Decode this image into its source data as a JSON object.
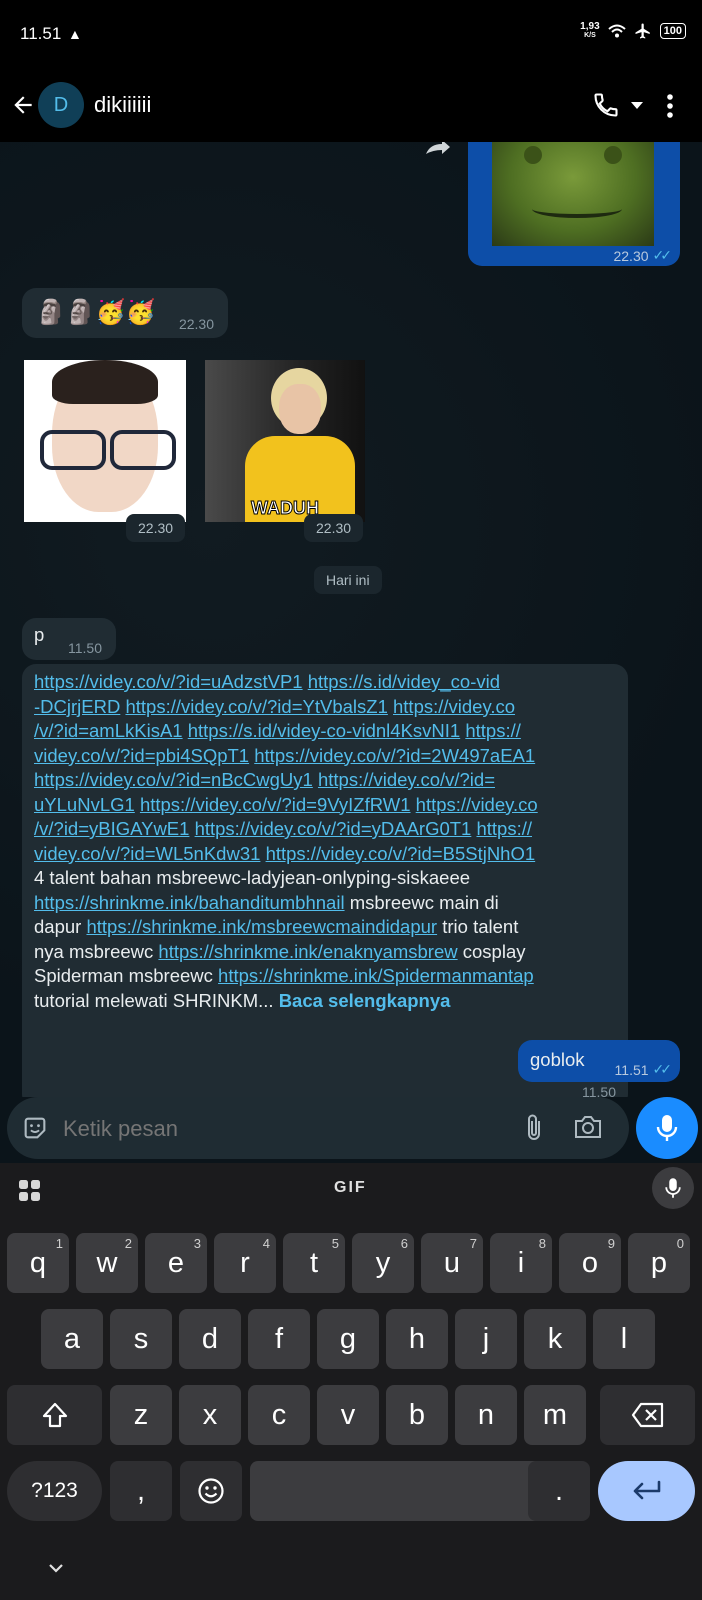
{
  "status": {
    "time": "11.51",
    "speed": "1,93",
    "speed_unit": "K/S",
    "battery": "100"
  },
  "header": {
    "avatar_letter": "D",
    "contact_name": "dikiiiiii"
  },
  "messages": {
    "img_out_time": "22.30",
    "emoji_msg": "🗿🗿🥳🥳",
    "emoji_time": "22.30",
    "sticker1_time": "22.30",
    "sticker2_time": "22.30",
    "sticker2_caption": "WADUH",
    "date_pill": "Hari ini",
    "p_text": "p",
    "p_time": "11.50",
    "long_time": "11.50",
    "goblok_text": "goblok",
    "goblok_time": "11.51"
  },
  "long_message": {
    "lines": [
      [
        {
          "t": "https://videy.co/v/?id=uAdzstVP1",
          "l": true
        },
        {
          "t": " ",
          "l": false
        },
        {
          "t": "https://s.id/videy_co-vid",
          "l": true
        }
      ],
      [
        {
          "t": "-DCjrjERD",
          "l": true
        },
        {
          "t": " ",
          "l": false
        },
        {
          "t": "https://videy.co/v/?id=YtVbalsZ1",
          "l": true
        },
        {
          "t": " ",
          "l": false
        },
        {
          "t": "https://videy.co",
          "l": true
        }
      ],
      [
        {
          "t": "/v/?id=amLkKisA1",
          "l": true
        },
        {
          "t": " ",
          "l": false
        },
        {
          "t": "https://s.id/videy-co-vidnl4KsvNI1",
          "l": true
        },
        {
          "t": " ",
          "l": false
        },
        {
          "t": "https://",
          "l": true
        }
      ],
      [
        {
          "t": "videy.co/v/?id=pbi4SQpT1",
          "l": true
        },
        {
          "t": " ",
          "l": false
        },
        {
          "t": "https://videy.co/v/?id=2W497aEA1",
          "l": true
        }
      ],
      [
        {
          "t": "https://videy.co/v/?id=nBcCwgUy1",
          "l": true
        },
        {
          "t": " ",
          "l": false
        },
        {
          "t": "https://videy.co/v/?id=",
          "l": true
        }
      ],
      [
        {
          "t": "uYLuNvLG1",
          "l": true
        },
        {
          "t": " ",
          "l": false
        },
        {
          "t": "https://videy.co/v/?id=9VyIZfRW1",
          "l": true
        },
        {
          "t": " ",
          "l": false
        },
        {
          "t": "https://videy.co",
          "l": true
        }
      ],
      [
        {
          "t": "/v/?id=yBIGAYwE1",
          "l": true
        },
        {
          "t": " ",
          "l": false
        },
        {
          "t": "https://videy.co/v/?id=yDAArG0T1",
          "l": true
        },
        {
          "t": " ",
          "l": false
        },
        {
          "t": "https://",
          "l": true
        }
      ],
      [
        {
          "t": "videy.co/v/?id=WL5nKdw31",
          "l": true
        },
        {
          "t": " ",
          "l": false
        },
        {
          "t": "https://videy.co/v/?id=B5StjNhO1",
          "l": true
        }
      ],
      [
        {
          "t": "4 talent bahan msbreewc-ladyjean-onlyping-siskaeee",
          "l": false
        }
      ],
      [
        {
          "t": "https://shrinkme.ink/bahanditumbhnail",
          "l": true
        },
        {
          "t": " msbreewc main di",
          "l": false
        }
      ],
      [
        {
          "t": "dapur ",
          "l": false
        },
        {
          "t": "https://shrinkme.ink/msbreewcmaindidapur",
          "l": true
        },
        {
          "t": " trio talent",
          "l": false
        }
      ],
      [
        {
          "t": "nya msbreewc ",
          "l": false
        },
        {
          "t": "https://shrinkme.ink/enaknyamsbrew",
          "l": true
        },
        {
          "t": " cosplay",
          "l": false
        }
      ],
      [
        {
          "t": "Spiderman msbreewc ",
          "l": false
        },
        {
          "t": "https://shrinkme.ink/Spidermanmantap",
          "l": true
        }
      ],
      [
        {
          "t": "tutorial melewati SHRINKM... ",
          "l": false
        },
        {
          "t": "Baca selengkapnya",
          "l": "more"
        }
      ]
    ]
  },
  "input": {
    "placeholder": "Ketik pesan"
  },
  "keyboard": {
    "toolbar_gif": "GIF",
    "row1": [
      {
        "k": "q",
        "n": "1"
      },
      {
        "k": "w",
        "n": "2"
      },
      {
        "k": "e",
        "n": "3"
      },
      {
        "k": "r",
        "n": "4"
      },
      {
        "k": "t",
        "n": "5"
      },
      {
        "k": "y",
        "n": "6"
      },
      {
        "k": "u",
        "n": "7"
      },
      {
        "k": "i",
        "n": "8"
      },
      {
        "k": "o",
        "n": "9"
      },
      {
        "k": "p",
        "n": "0"
      }
    ],
    "row2": [
      "a",
      "s",
      "d",
      "f",
      "g",
      "h",
      "j",
      "k",
      "l"
    ],
    "row3": [
      "z",
      "x",
      "c",
      "v",
      "b",
      "n",
      "m"
    ],
    "sym": "?123",
    "comma": ",",
    "period": "."
  }
}
